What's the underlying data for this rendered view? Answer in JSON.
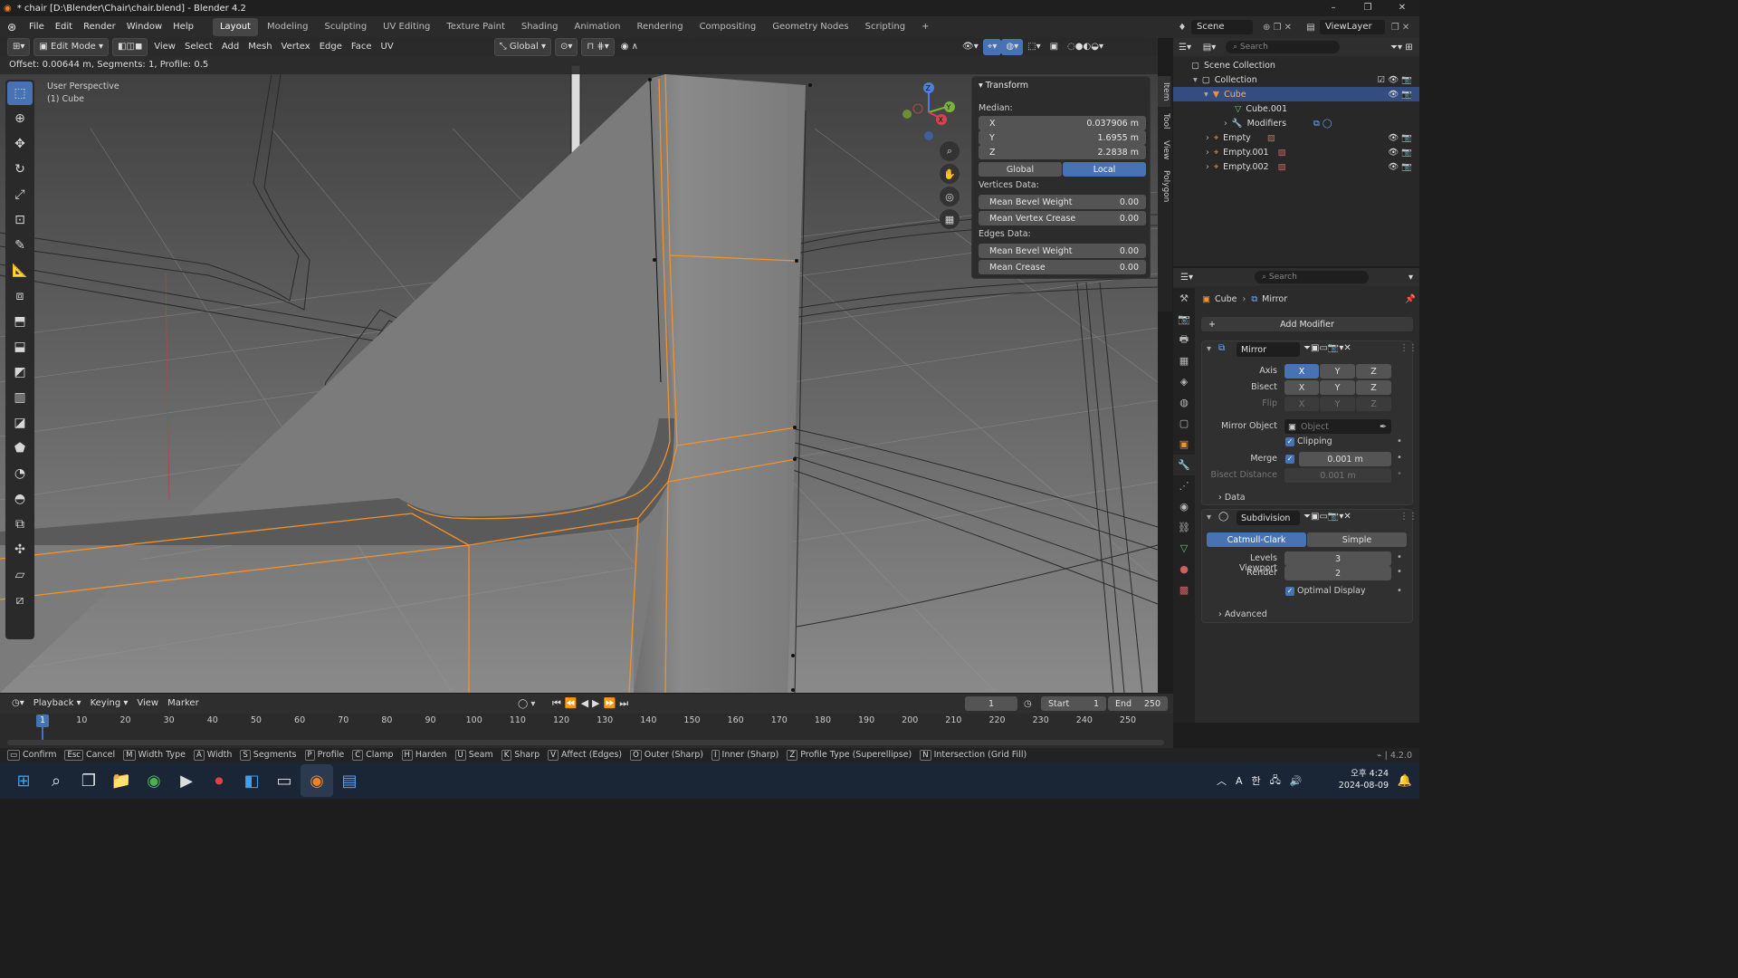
{
  "window": {
    "title": "* chair [D:\\Blender\\Chair\\chair.blend] - Blender 4.2",
    "controls": [
      "–",
      "❐",
      "✕"
    ]
  },
  "menubar": {
    "items": [
      "File",
      "Edit",
      "Render",
      "Window",
      "Help"
    ],
    "workspaces": [
      "Layout",
      "Modeling",
      "Sculpting",
      "UV Editing",
      "Texture Paint",
      "Shading",
      "Animation",
      "Rendering",
      "Compositing",
      "Geometry Nodes",
      "Scripting"
    ],
    "active_workspace": "Layout",
    "scene": "Scene",
    "view_layer": "ViewLayer"
  },
  "viewport": {
    "mode": "Edit Mode",
    "menus": [
      "View",
      "Select",
      "Add",
      "Mesh",
      "Vertex",
      "Edge",
      "Face",
      "UV"
    ],
    "orientation": "Global",
    "operator_info": "Offset: 0.00644 m, Segments: 1, Profile: 0.5",
    "view_label": "User Perspective",
    "object_label": "(1) Cube",
    "gizmo": {
      "z": "Z",
      "y": "Y",
      "x": "X"
    }
  },
  "transform_panel": {
    "title": "Transform",
    "median_label": "Median:",
    "x_label": "X",
    "x_value": "0.037906 m",
    "y_label": "Y",
    "y_value": "1.6955 m",
    "z_label": "Z",
    "z_value": "2.2838 m",
    "global_label": "Global",
    "local_label": "Local",
    "vertices_label": "Vertices Data:",
    "mean_bevel_weight_v_label": "Mean Bevel Weight",
    "mean_bevel_weight_v": "0.00",
    "mean_vertex_crease_label": "Mean Vertex Crease",
    "mean_vertex_crease": "0.00",
    "edges_label": "Edges Data:",
    "mean_bevel_weight_e_label": "Mean Bevel Weight",
    "mean_bevel_weight_e": "0.00",
    "mean_crease_label": "Mean Crease",
    "mean_crease": "0.00"
  },
  "side_tabs": [
    "Item",
    "Tool",
    "View",
    "Polygon"
  ],
  "outliner": {
    "search_placeholder": "Search",
    "scene_collection": "Scene Collection",
    "collection": "Collection",
    "items": [
      {
        "name": "Cube",
        "indent": 2,
        "selected": true
      },
      {
        "name": "Cube.001",
        "indent": 3,
        "selected": false
      },
      {
        "name": "Modifiers",
        "indent": 3,
        "selected": false
      },
      {
        "name": "Empty",
        "indent": 2,
        "selected": false
      },
      {
        "name": "Empty.001",
        "indent": 2,
        "selected": false
      },
      {
        "name": "Empty.002",
        "indent": 2,
        "selected": false
      }
    ]
  },
  "properties": {
    "search_placeholder": "Search",
    "breadcrumb_object": "Cube",
    "breadcrumb_modifier": "Mirror",
    "add_modifier": "Add Modifier",
    "mirror": {
      "name": "Mirror",
      "axis_label": "Axis",
      "bisect_label": "Bisect",
      "flip_label": "Flip",
      "xyz": [
        "X",
        "Y",
        "Z"
      ],
      "mirror_object_label": "Mirror Object",
      "mirror_object_placeholder": "Object",
      "clipping_label": "Clipping",
      "merge_label": "Merge",
      "merge_value": "0.001 m",
      "bisect_distance_label": "Bisect Distance",
      "bisect_distance_value": "0.001 m",
      "data_label": "Data"
    },
    "subdivision": {
      "name": "Subdivision",
      "catmull": "Catmull-Clark",
      "simple": "Simple",
      "levels_viewport_label": "Levels Viewport",
      "levels_viewport": "3",
      "render_label": "Render",
      "render": "2",
      "optimal_display_label": "Optimal Display",
      "advanced_label": "Advanced"
    }
  },
  "timeline": {
    "menus": [
      "Playback",
      "Keying",
      "View",
      "Marker"
    ],
    "current_frame": "1",
    "start_label": "Start",
    "start": "1",
    "end_label": "End",
    "end": "250",
    "ticks": [
      "1",
      "10",
      "20",
      "30",
      "40",
      "50",
      "60",
      "70",
      "80",
      "90",
      "100",
      "110",
      "120",
      "130",
      "140",
      "150",
      "160",
      "170",
      "180",
      "190",
      "200",
      "210",
      "220",
      "230",
      "240",
      "250"
    ]
  },
  "statusbar": {
    "items": [
      {
        "key": "",
        "label": "Confirm"
      },
      {
        "key": "Esc",
        "label": "Cancel"
      },
      {
        "key": "M",
        "label": "Width Type"
      },
      {
        "key": "A",
        "label": "Width"
      },
      {
        "key": "S",
        "label": "Segments"
      },
      {
        "key": "P",
        "label": "Profile"
      },
      {
        "key": "C",
        "label": "Clamp"
      },
      {
        "key": "H",
        "label": "Harden"
      },
      {
        "key": "U",
        "label": "Seam"
      },
      {
        "key": "K",
        "label": "Sharp"
      },
      {
        "key": "V",
        "label": "Affect (Edges)"
      },
      {
        "key": "O",
        "label": "Outer (Sharp)"
      },
      {
        "key": "I",
        "label": "Inner (Sharp)"
      },
      {
        "key": "Z",
        "label": "Profile Type (Superellipse)"
      },
      {
        "key": "N",
        "label": "Intersection (Grid Fill)"
      }
    ],
    "version": "4.2.0"
  },
  "taskbar": {
    "time": "오후 4:24",
    "date": "2024-08-09",
    "ime_a": "A",
    "ime_han": "한"
  },
  "colors": {
    "accent": "#4772b3",
    "selection_orange": "#f0922b",
    "viewport_bg": "#3a3a3a"
  }
}
